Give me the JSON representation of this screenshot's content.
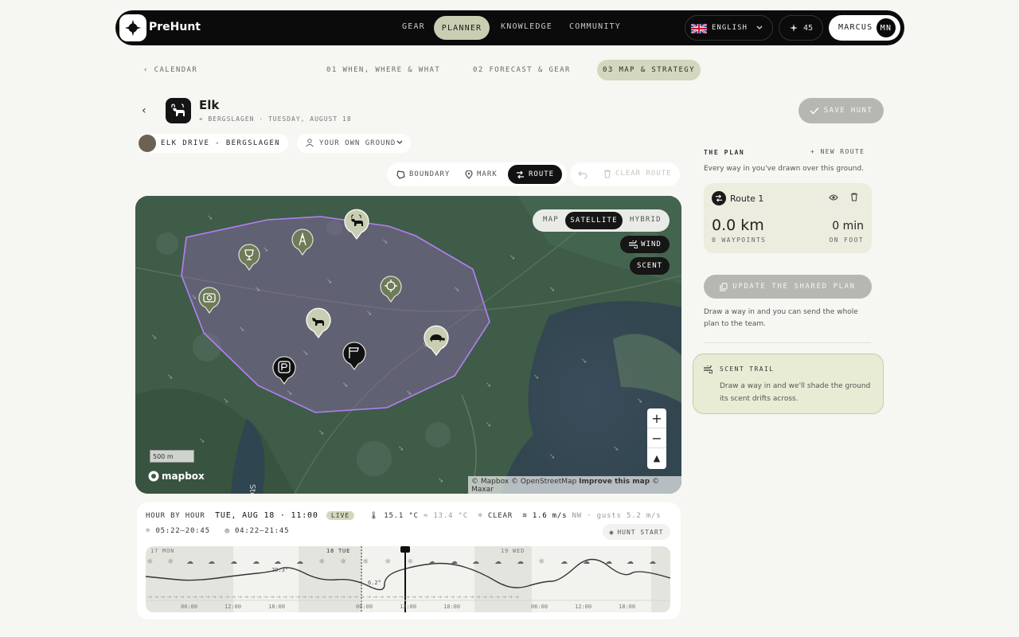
{
  "app": {
    "name": "PreHunt"
  },
  "nav": {
    "links": [
      "GEAR",
      "PLANNER",
      "KNOWLEDGE",
      "COMMUNITY"
    ],
    "active": "PLANNER",
    "language": "ENGLISH",
    "count": "45",
    "user": "MARCUS",
    "user_initials": "MN"
  },
  "steps": {
    "back": "CALENDAR",
    "items": [
      "01 WHEN, WHERE & WHAT",
      "02 FORECAST & GEAR",
      "03 MAP & STRATEGY"
    ],
    "active_index": 2
  },
  "hunt": {
    "species": "Elk",
    "location": "BERGSLAGEN · TUESDAY, AUGUST 18",
    "save_label": "SAVE HUNT",
    "drive_name": "ELK DRIVE - BERGSLAGEN",
    "ground": "YOUR OWN GROUND"
  },
  "tools": {
    "boundary": "BOUNDARY",
    "mark": "MARK",
    "route": "ROUTE",
    "clear_route": "CLEAR ROUTE"
  },
  "map": {
    "types": [
      "MAP",
      "SATELLITE",
      "HYBRID"
    ],
    "active_type": "SATELLITE",
    "wind": "WIND",
    "scent": "SCENT",
    "scale": "500 m",
    "provider": "mapbox",
    "attribution_1": "© Mapbox © OpenStreetMap",
    "attribution_improve": "Improve this map",
    "attribution_2": "© Maxar",
    "place_label": "Sto",
    "markers": [
      "elk",
      "hunting-tower",
      "trophy",
      "crosshair",
      "camera",
      "moose",
      "parking",
      "wind-sock",
      "turtle"
    ]
  },
  "weather": {
    "hour_label": "HOUR BY HOUR",
    "datetime": "TUE, AUG 18 · 11:00",
    "live": "LIVE",
    "temp": "15.1 °C",
    "feels": "≈ 13.4 °C",
    "sky": "CLEAR",
    "wind": "1.6 m/s",
    "wind_dir": "NW · gusts 5.2 m/s",
    "sun": "05:22–20:45",
    "moon": "04:22–21:45",
    "hunt_start": "HUNT START",
    "days": [
      "17 MON",
      "18 TUE",
      "19 WED"
    ],
    "ticks": [
      "06:00",
      "12:00",
      "18:00",
      "06:00",
      "12:00",
      "18:00",
      "06:00",
      "12:00",
      "18:00"
    ],
    "max_label": "20.3°",
    "min_label": "6.2°"
  },
  "plan": {
    "title": "THE PLAN",
    "new_route": "NEW ROUTE",
    "subtitle": "Every way in you've drawn over this ground.",
    "route_name": "Route 1",
    "distance": "0.0 km",
    "waypoints": "0 WAYPOINTS",
    "duration": "0 min",
    "mode": "ON FOOT",
    "update_label": "UPDATE THE SHARED PLAN",
    "update_note": "Draw a way in and you can send the whole plan to the team.",
    "scent_title": "SCENT TRAIL",
    "scent_text": "Draw a way in and we'll shade the ground its scent drifts across."
  }
}
